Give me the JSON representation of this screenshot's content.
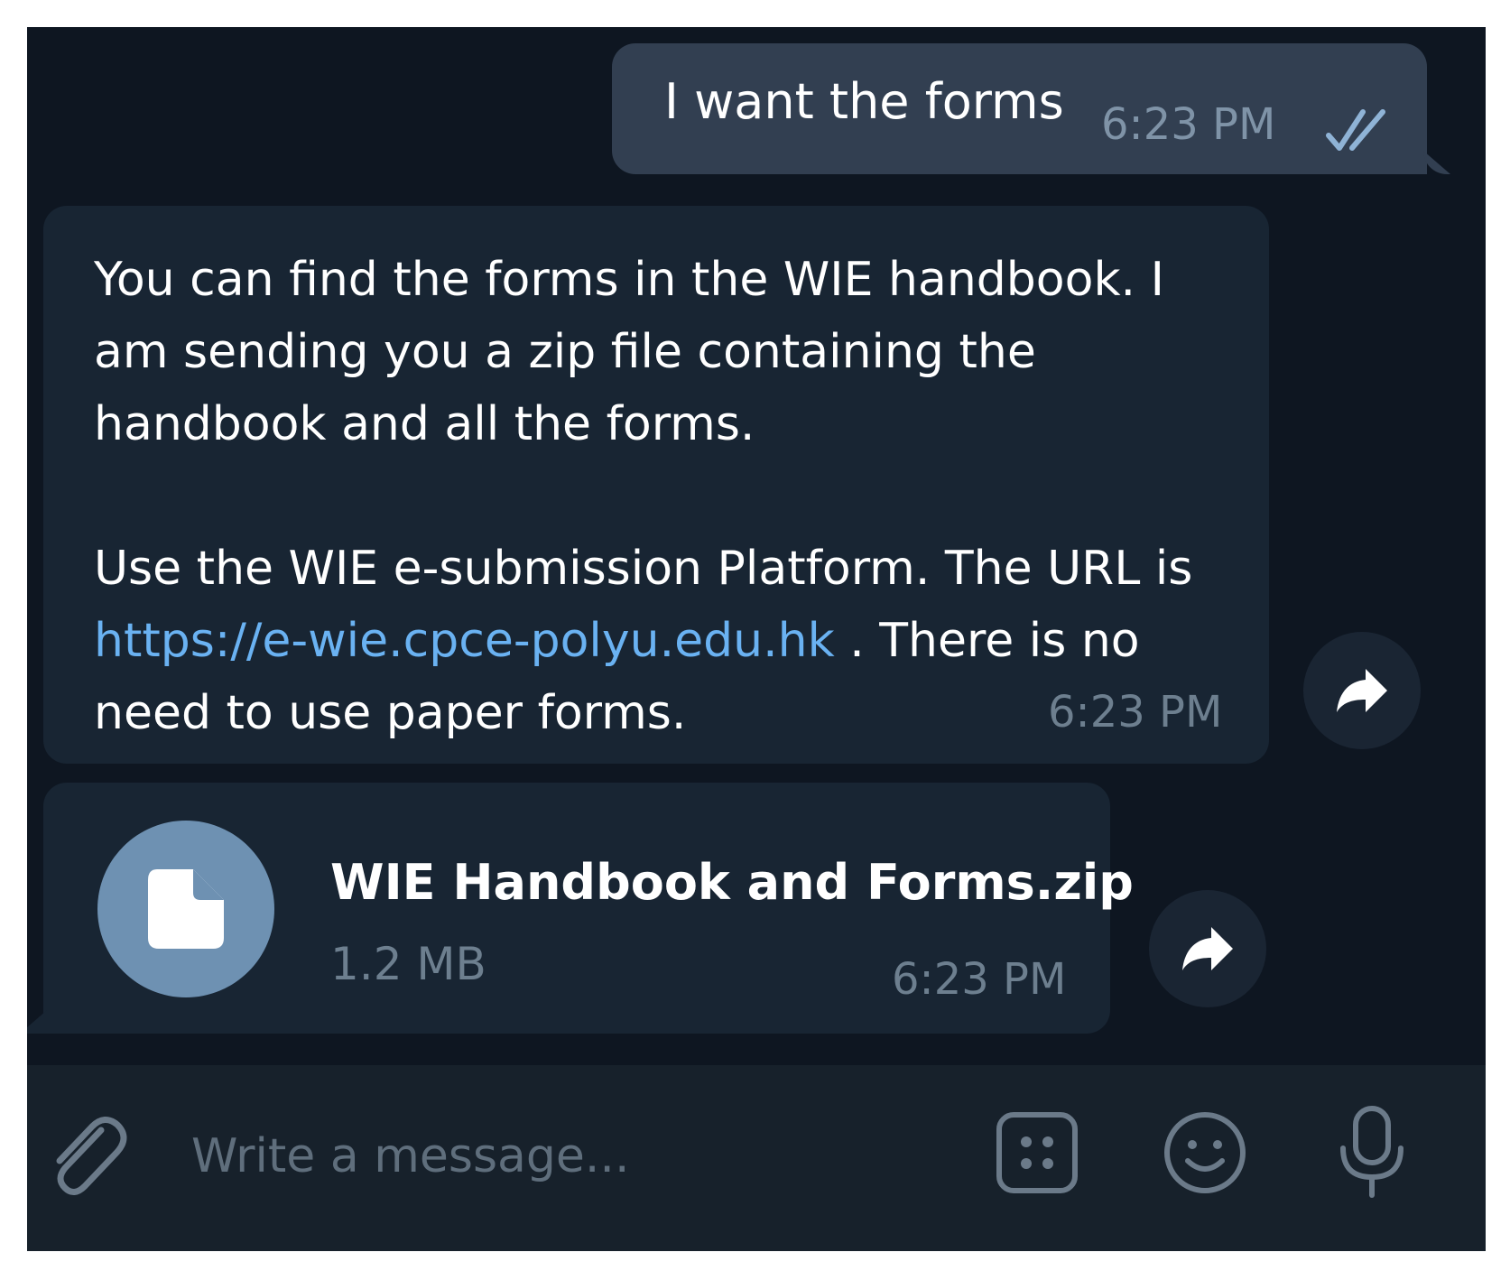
{
  "messages": {
    "outgoing": {
      "text": "I want the forms",
      "time": "6:23 PM",
      "status_icon": "double-check-icon"
    },
    "incoming_text": {
      "paragraph_1": "You can find the forms in the WIE handbook. I am sending you a zip file containing the handbook and all the forms.",
      "paragraph_2_prefix": "Use the WIE e-submission Platform. The URL is",
      "link": "https://e-wie.cpce-polyu.edu.hk",
      "paragraph_2_suffix": ". There is no need to use paper forms.",
      "time": "6:23 PM"
    },
    "incoming_file": {
      "file_name": "WIE Handbook and Forms.zip",
      "file_size": "1.2 MB",
      "time": "6:23 PM",
      "icon": "file-icon"
    }
  },
  "composer": {
    "placeholder": "Write a message...",
    "icons": [
      "paperclip-icon",
      "bot-commands-icon",
      "emoji-icon",
      "microphone-icon"
    ]
  },
  "colors": {
    "background": "#0e1621",
    "outgoing_bubble": "#323f51",
    "incoming_bubble": "#182533",
    "link": "#6ab2f2",
    "file_icon_circle": "#6e91b2",
    "composer": "#17212b"
  }
}
